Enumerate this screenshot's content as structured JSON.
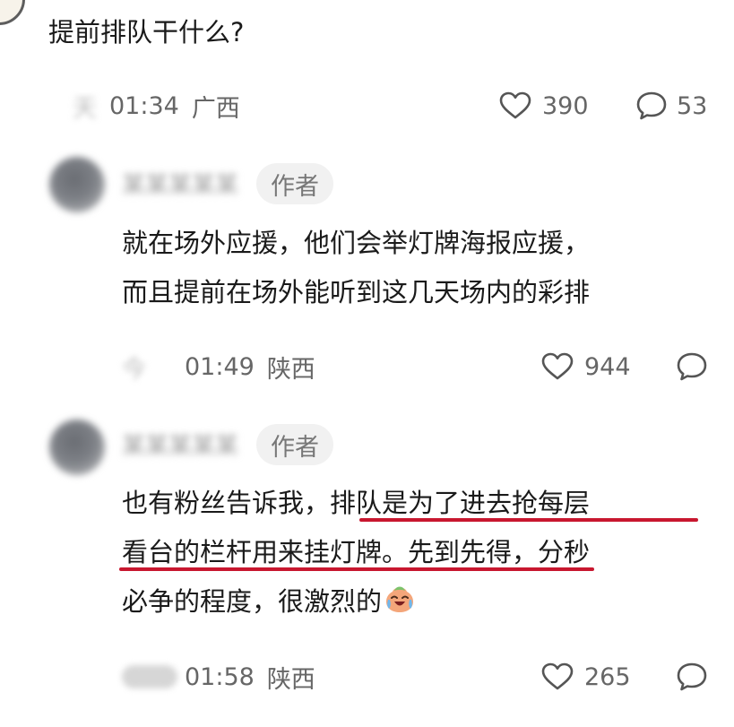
{
  "question": {
    "text": "提前排队干什么?",
    "meta": {
      "day_blurred": "天",
      "time": "01:34",
      "location": "广西",
      "likes": "390",
      "replies": "53"
    }
  },
  "replies": [
    {
      "username_blurred": "",
      "badge": "作者",
      "lines": [
        "就在场外应援，他们会举灯牌海报应援，",
        "而且提前在场外能听到这几天场内的彩排"
      ],
      "meta": {
        "day_blurred": "今",
        "time": "01:49",
        "location": "陕西",
        "likes": "944"
      }
    },
    {
      "username_blurred": "",
      "badge": "作者",
      "segments": {
        "line1_plain": "也有粉丝告诉我，",
        "line1_highlight": "排队是为了进去抢每层",
        "line2_highlight": "看台的栏杆用来挂灯牌。先到先得",
        "line2_plain": "，分秒",
        "line3_plain": "必争的程度，很激烈的"
      },
      "emoji": "crying-laughing-face-icon",
      "meta": {
        "day_blurred": "",
        "time": "01:58",
        "location": "陕西",
        "likes": "265"
      }
    }
  ],
  "colors": {
    "highlight_underline": "#c8172f",
    "meta_text": "#666666",
    "badge_bg": "#f1f1f1"
  }
}
